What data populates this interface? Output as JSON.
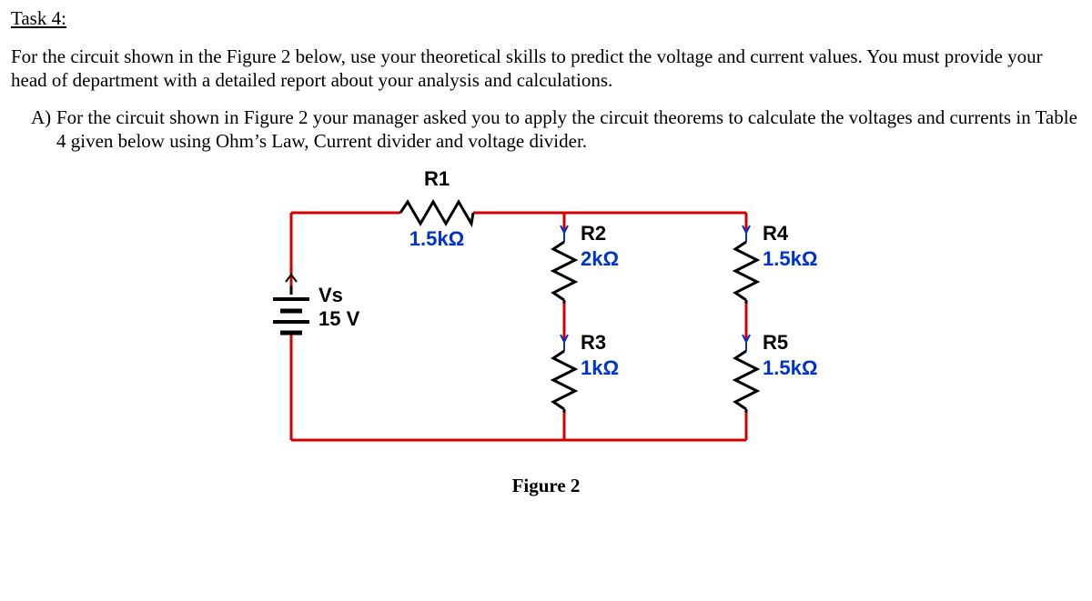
{
  "task": {
    "title": "Task 4:",
    "intro": "For the circuit shown in the Figure 2 below, use your theoretical skills to predict the voltage and current values. You must provide your head of department with a detailed report about your analysis and calculations.",
    "item_marker": "A)",
    "item_body": "For the circuit shown in Figure 2 your manager asked you to apply the circuit theorems to calculate the voltages and currents in Table 4 given below using Ohm’s Law, Current divider and voltage divider."
  },
  "circuit": {
    "source": {
      "name": "Vs",
      "value": "15 V"
    },
    "R1": {
      "name": "R1",
      "value": "1.5kΩ"
    },
    "R2": {
      "name": "R2",
      "value": "2kΩ"
    },
    "R3": {
      "name": "R3",
      "value": "1kΩ"
    },
    "R4": {
      "name": "R4",
      "value": "1.5kΩ"
    },
    "R5": {
      "name": "R5",
      "value": "1.5kΩ"
    }
  },
  "figure_caption": "Figure 2"
}
